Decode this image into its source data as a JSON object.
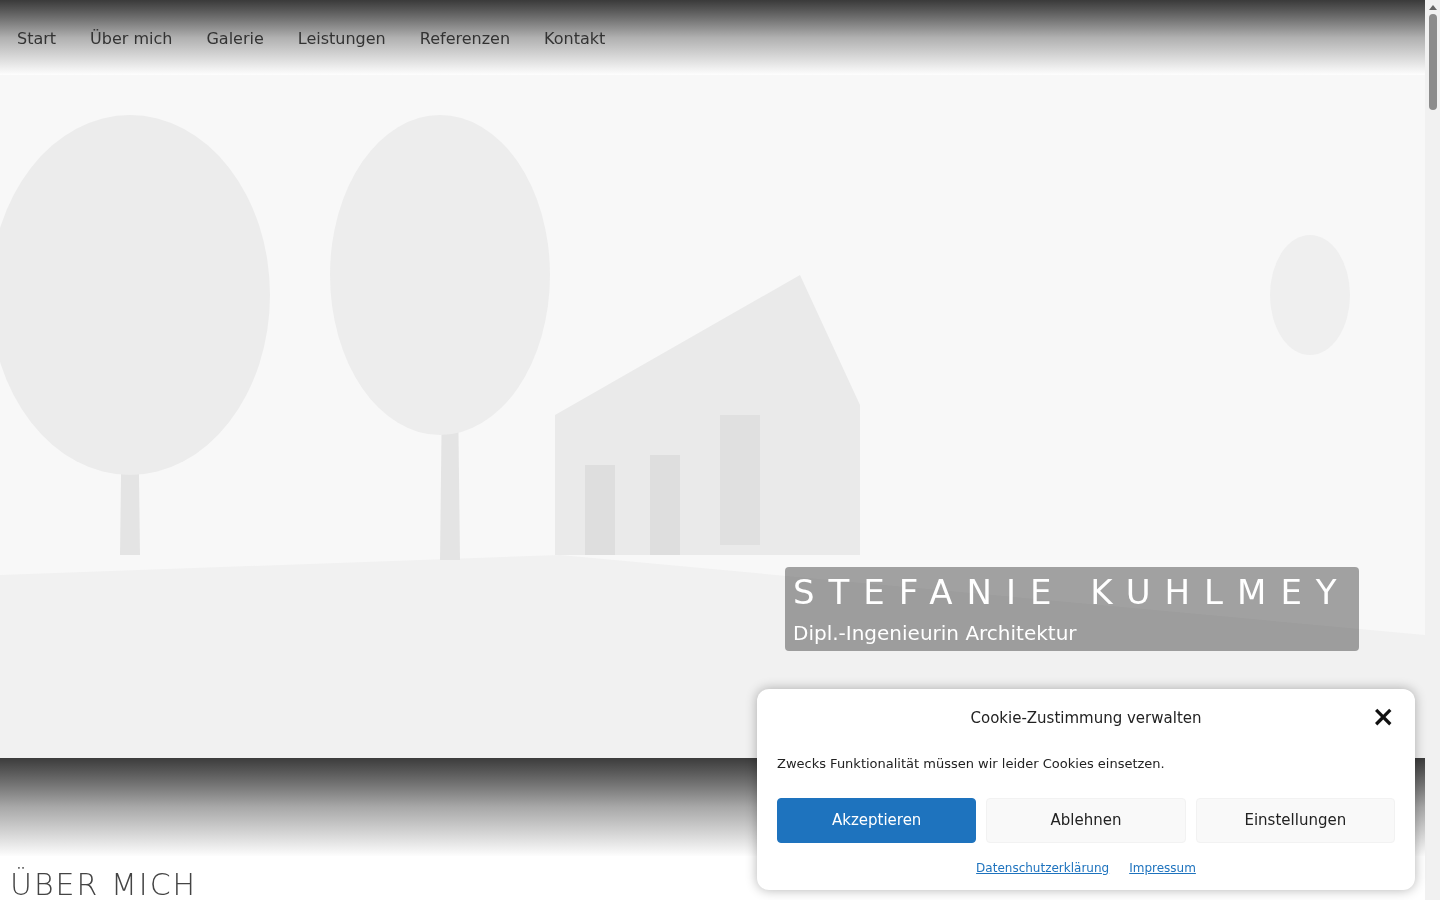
{
  "nav": [
    {
      "label": "Start"
    },
    {
      "label": "Über mich"
    },
    {
      "label": "Galerie"
    },
    {
      "label": "Leistungen"
    },
    {
      "label": "Referenzen"
    },
    {
      "label": "Kontakt"
    }
  ],
  "hero": {
    "kind": "picture",
    "title": "STEFANIE KUHLMEY",
    "subtitle": "Dipl.-Ingenieurin Architektur"
  },
  "section_heading": "ÜBER MICH",
  "cookie_dialog": {
    "title": "Cookie-Zustimmung verwalten",
    "close": "×",
    "message": "Zwecks Funktionalität müssen wir leider Cookies einsetzen.",
    "buttons": [
      {
        "label": "Akzeptieren",
        "kind": "primary"
      },
      {
        "label": "Ablehnen",
        "kind": "secondary"
      },
      {
        "label": "Einstellungen",
        "kind": "secondary"
      }
    ],
    "links": [
      "Datenschutzerklärung",
      "Impressum"
    ]
  }
}
